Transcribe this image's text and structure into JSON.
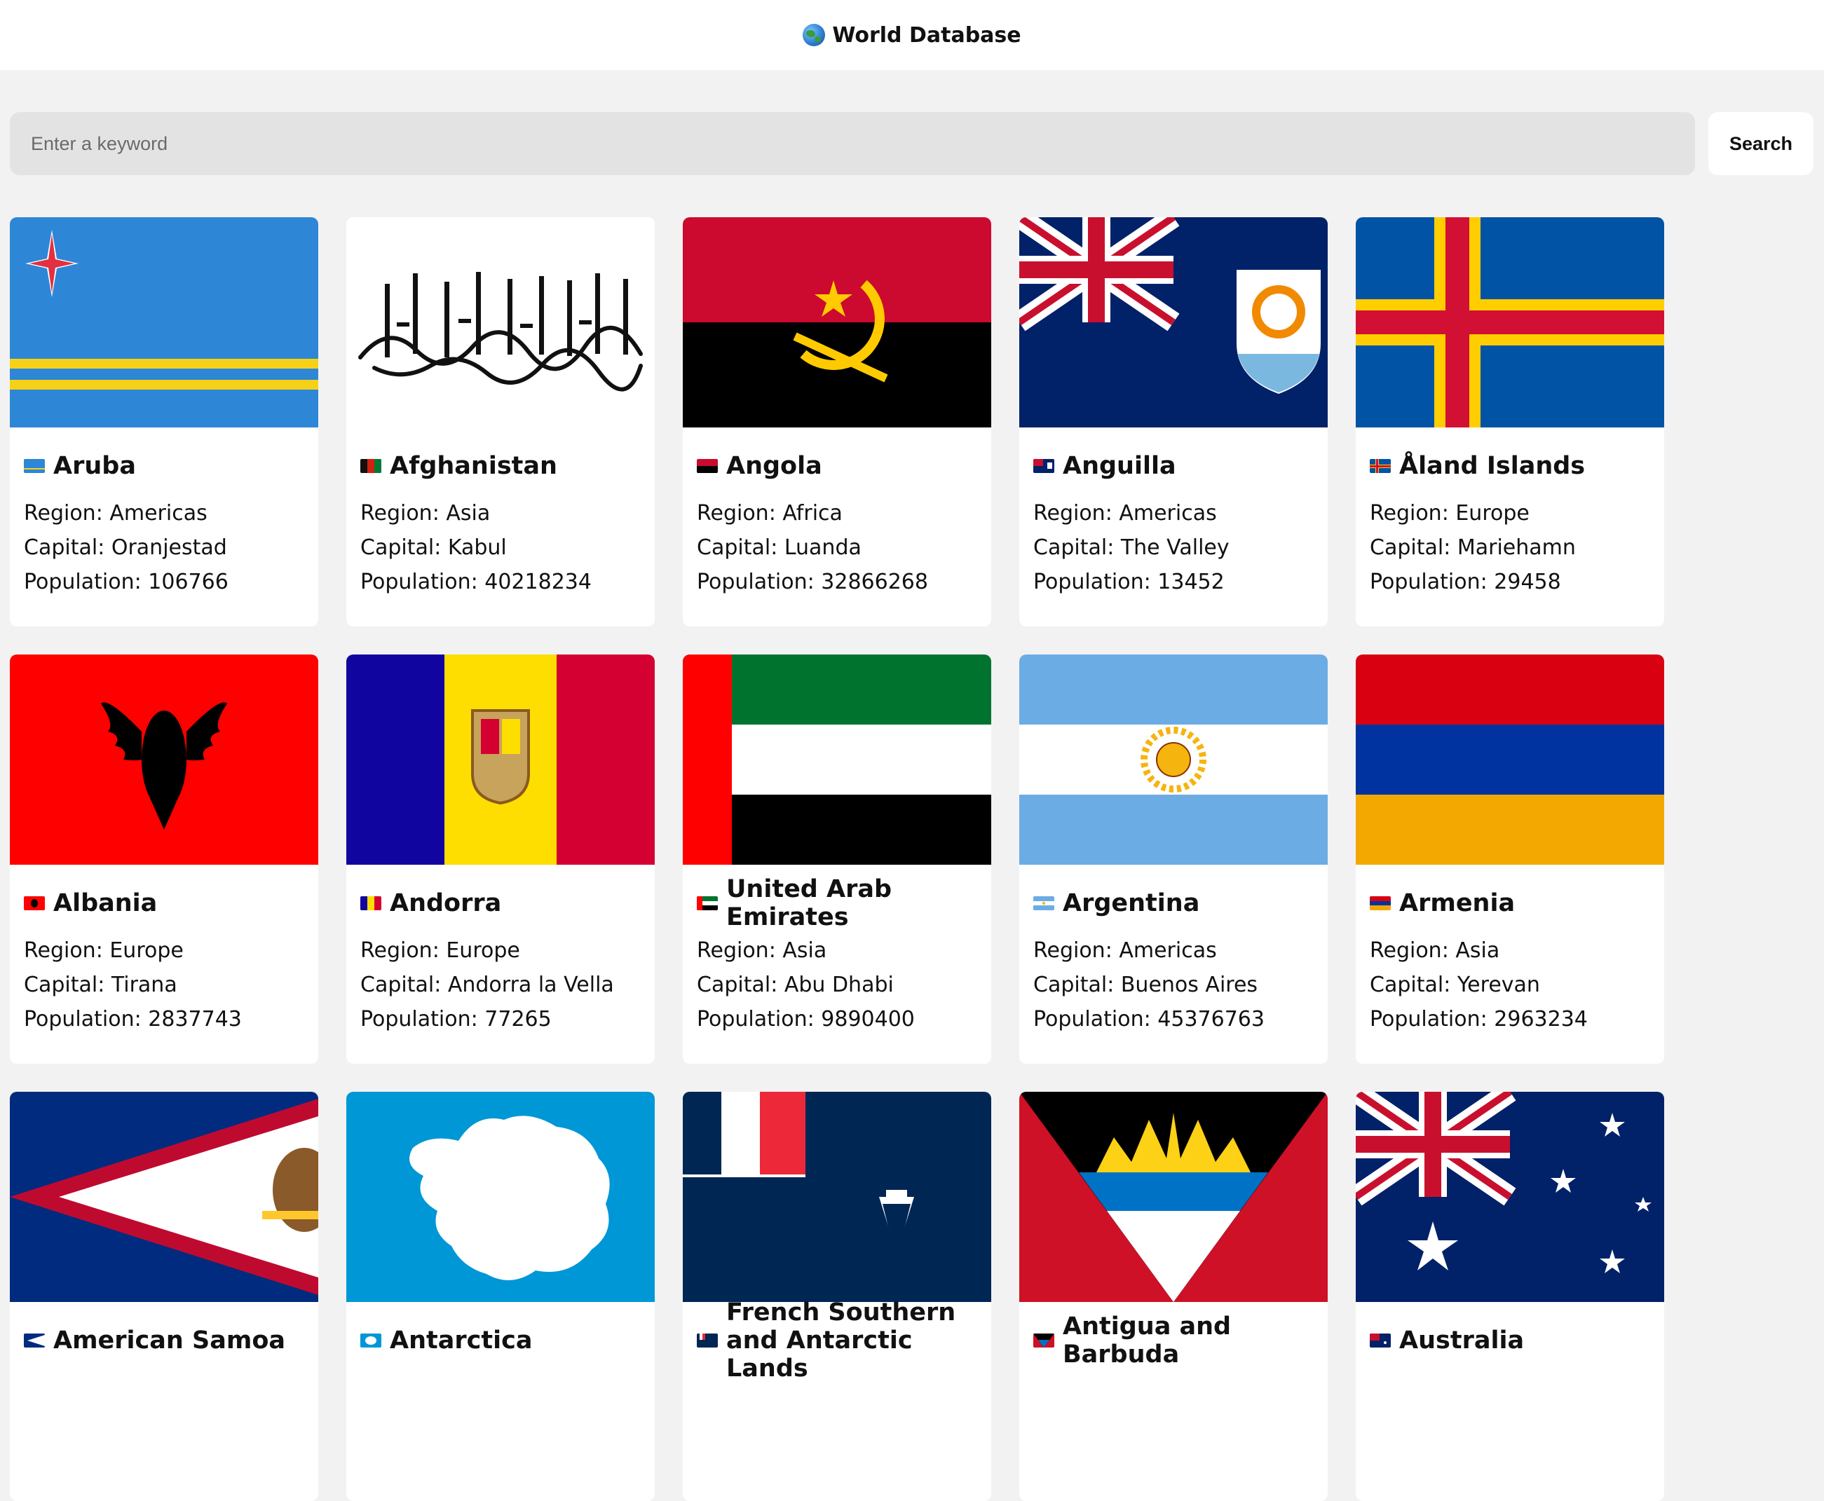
{
  "header": {
    "globe_icon": "globe-icon",
    "title": "World Database"
  },
  "search": {
    "placeholder": "Enter a keyword",
    "value": "",
    "button_label": "Search"
  },
  "labels": {
    "region": "Region: ",
    "capital": "Capital: ",
    "population": "Population: "
  },
  "countries": [
    {
      "name": "Aruba",
      "region": "Americas",
      "capital": "Oranjestad",
      "population": "106766",
      "flag": "aruba-flag"
    },
    {
      "name": "Afghanistan",
      "region": "Asia",
      "capital": "Kabul",
      "population": "40218234",
      "flag": "afghanistan-flag"
    },
    {
      "name": "Angola",
      "region": "Africa",
      "capital": "Luanda",
      "population": "32866268",
      "flag": "angola-flag"
    },
    {
      "name": "Anguilla",
      "region": "Americas",
      "capital": "The Valley",
      "population": "13452",
      "flag": "anguilla-flag"
    },
    {
      "name": "Åland Islands",
      "region": "Europe",
      "capital": "Mariehamn",
      "population": "29458",
      "flag": "aland-islands-flag"
    },
    {
      "name": "Albania",
      "region": "Europe",
      "capital": "Tirana",
      "population": "2837743",
      "flag": "albania-flag"
    },
    {
      "name": "Andorra",
      "region": "Europe",
      "capital": "Andorra la Vella",
      "population": "77265",
      "flag": "andorra-flag"
    },
    {
      "name": "United Arab Emirates",
      "region": "Asia",
      "capital": "Abu Dhabi",
      "population": "9890400",
      "flag": "uae-flag"
    },
    {
      "name": "Argentina",
      "region": "Americas",
      "capital": "Buenos Aires",
      "population": "45376763",
      "flag": "argentina-flag"
    },
    {
      "name": "Armenia",
      "region": "Asia",
      "capital": "Yerevan",
      "population": "2963234",
      "flag": "armenia-flag"
    },
    {
      "name": "American Samoa",
      "flag": "american-samoa-flag"
    },
    {
      "name": "Antarctica",
      "flag": "antarctica-flag"
    },
    {
      "name": "French Southern and Antarctic Lands",
      "flag": "french-southern-lands-flag"
    },
    {
      "name": "Antigua and Barbuda",
      "flag": "antigua-and-barbuda-flag"
    },
    {
      "name": "Australia",
      "flag": "australia-flag"
    }
  ]
}
